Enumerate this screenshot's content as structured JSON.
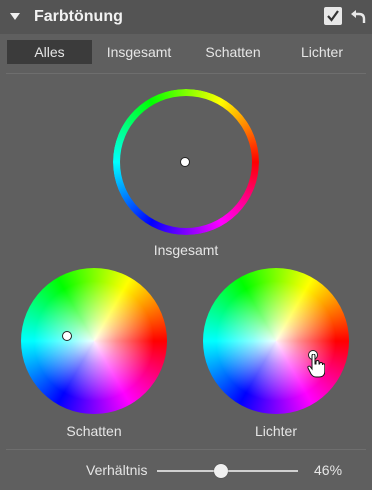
{
  "panel": {
    "title": "Farbtönung",
    "enabled": true,
    "icons": {
      "collapse": "triangle-down",
      "enable": "checkbox-checked",
      "reset": "undo-arrow"
    }
  },
  "tabs": [
    {
      "label": "Alles",
      "active": true
    },
    {
      "label": "Insgesamt",
      "active": false
    },
    {
      "label": "Schatten",
      "active": false
    },
    {
      "label": "Lichter",
      "active": false
    }
  ],
  "wheels": {
    "insgesamt": {
      "label": "Insgesamt"
    },
    "schatten": {
      "label": "Schatten"
    },
    "lichter": {
      "label": "Lichter"
    }
  },
  "ratio": {
    "label": "Verhältnis",
    "value": 46,
    "display": "46%"
  },
  "colors": {
    "panel_bg": "#5f5f5f",
    "header_bg": "#545454",
    "active_tab_bg": "#3b3b3b"
  }
}
